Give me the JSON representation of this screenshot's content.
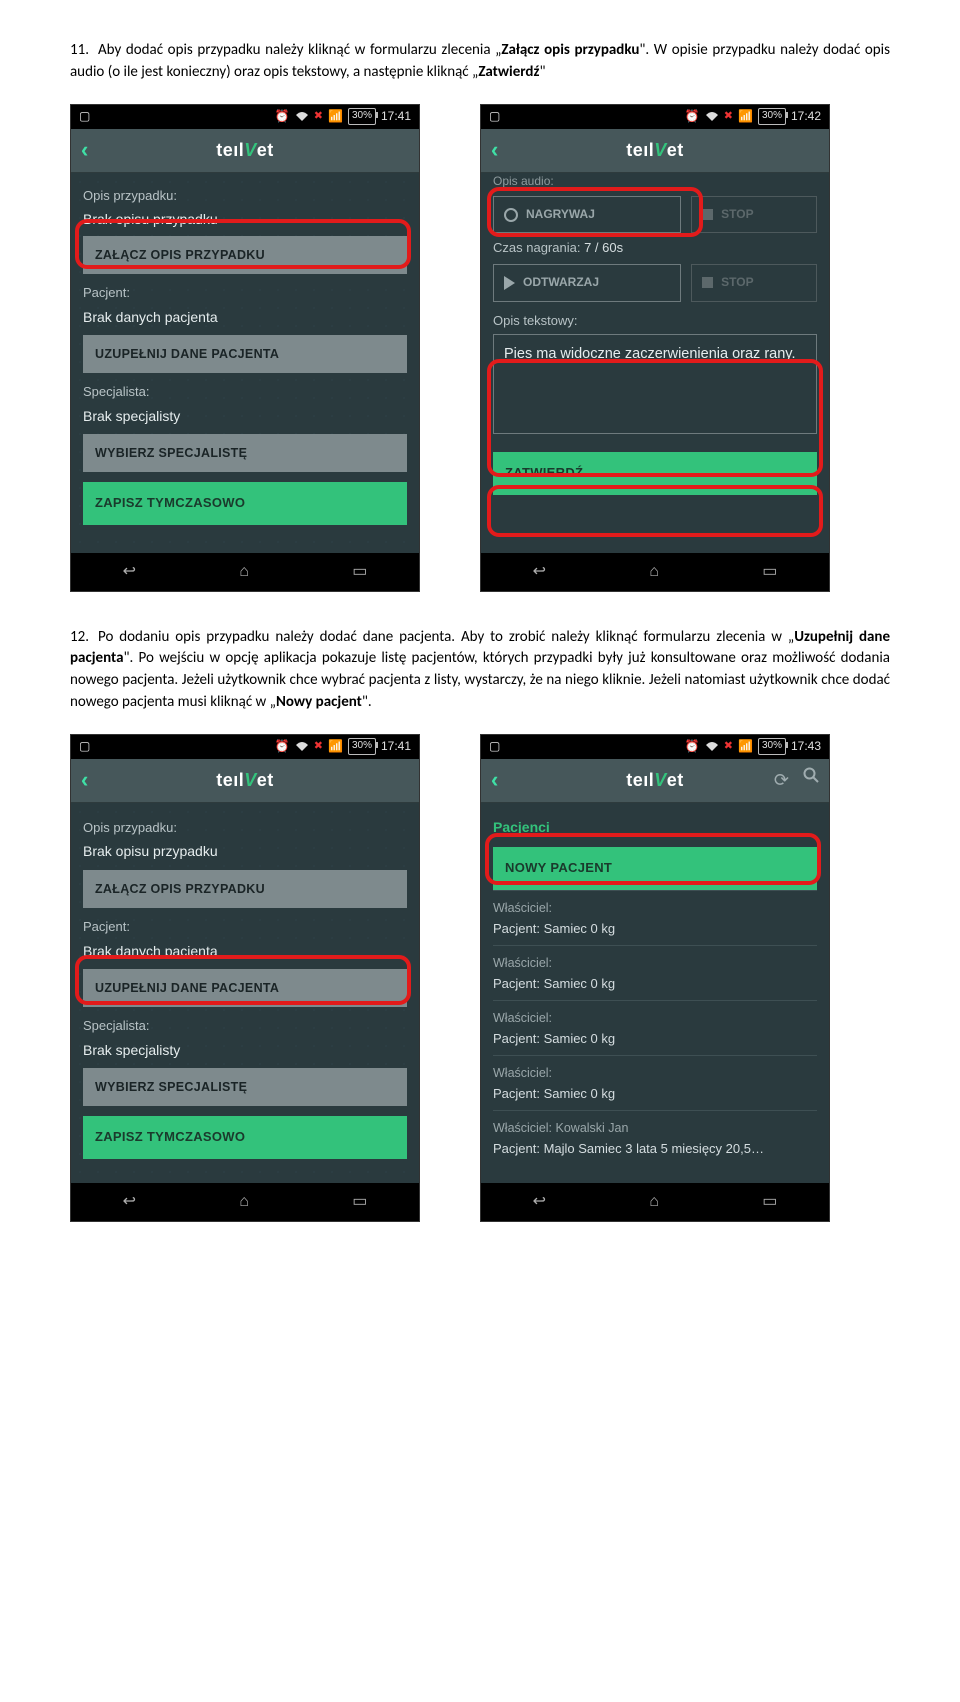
{
  "step11": {
    "num": "11.",
    "text_a": "Aby dodać opis przypadku należy kliknąć w formularzu zlecenia „",
    "bold_a": "Załącz opis przypadku",
    "text_b": "\". W opisie przypadku należy dodać opis audio (o ile jest konieczny) oraz opis tekstowy, a następnie kliknąć „",
    "bold_b": "Zatwierdź",
    "text_c": "\""
  },
  "step12": {
    "num": "12.",
    "text_a": "Po dodaniu opis przypadku należy dodać dane pacjenta. Aby to zrobić należy kliknąć formularzu zlecenia w „",
    "bold_a": "Uzupełnij dane pacjenta",
    "text_b": "\". Po wejściu w opcję aplikacja pokazuje listę pacjentów, których przypadki były już konsultowane oraz możliwość dodania nowego pacjenta. Jeżeli użytkownik chce wybrać pacjenta z listy, wystarczy, że na niego kliknie. Jeżeli natomiast użytkownik chce dodać nowego pacjenta musi kliknąć w „",
    "bold_b": "Nowy pacjent",
    "text_c": "\"."
  },
  "status": {
    "battery": "30%"
  },
  "times": {
    "a": "17:41",
    "b": "17:42",
    "c": "17:41",
    "d": "17:43"
  },
  "logo": {
    "pre": "teıl",
    "v": "V",
    "post": "et"
  },
  "screen1": {
    "label_case": "Opis przypadku:",
    "value_case": "Brak opisu przypadku",
    "btn_case": "ZAŁĄCZ OPIS PRZYPADKU",
    "label_patient": "Pacjent:",
    "value_patient": "Brak danych pacjenta",
    "btn_patient": "UZUPEŁNIJ DANE PACJENTA",
    "label_spec": "Specjalista:",
    "value_spec": "Brak specjalisty",
    "btn_spec": "WYBIERZ SPECJALISTĘ",
    "btn_save": "ZAPISZ TYMCZASOWO"
  },
  "screen2": {
    "label_audio_cut": "Opis audio:",
    "btn_rec": "NAGRYWAJ",
    "btn_stop": "STOP",
    "time_label": "Czas nagrania:",
    "time_value": "7  /  60s",
    "btn_play": "ODTWARZAJ",
    "label_text": "Opis tekstowy:",
    "textarea": "Pies ma widoczne zaczerwienienia oraz rany.",
    "btn_confirm": "ZATWIERDŹ"
  },
  "screen4": {
    "heading": "Pacjenci",
    "btn_new": "NOWY PACJENT",
    "items": [
      {
        "owner": "Właściciel:",
        "pat": "Pacjent:  Samiec  0 kg"
      },
      {
        "owner": "Właściciel:",
        "pat": "Pacjent:  Samiec  0 kg"
      },
      {
        "owner": "Właściciel:",
        "pat": "Pacjent:  Samiec  0 kg"
      },
      {
        "owner": "Właściciel:",
        "pat": "Pacjent:  Samiec  0 kg"
      },
      {
        "owner": "Właściciel: Kowalski Jan",
        "pat": "Pacjent: Majlo Samiec 3 lata 5 miesięcy 20,5…"
      }
    ]
  }
}
